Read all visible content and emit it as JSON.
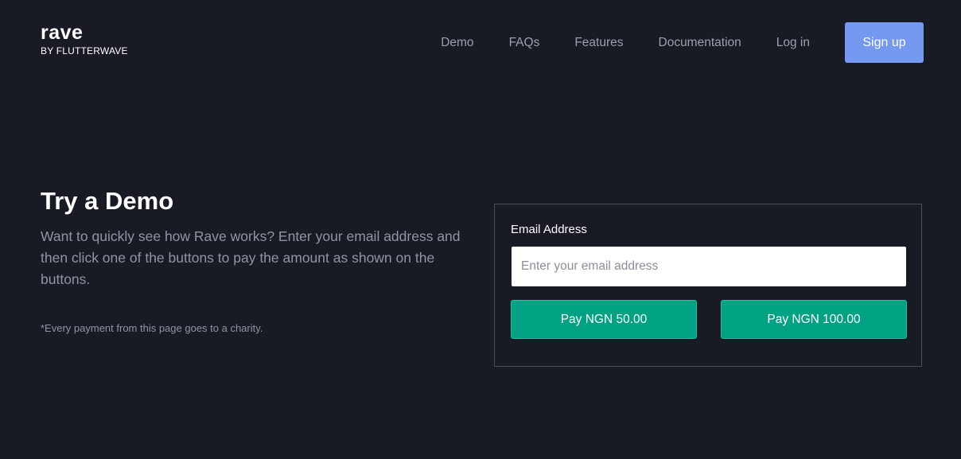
{
  "brand": {
    "name": "rave",
    "tagline": "BY FLUTTERWAVE"
  },
  "nav": {
    "links": [
      "Demo",
      "FAQs",
      "Features",
      "Documentation",
      "Log in"
    ],
    "signup_label": "Sign up"
  },
  "intro": {
    "title": "Try a Demo",
    "description": "Want to quickly see how Rave works? Enter your email address and then click one of the buttons to pay the amount as shown on the buttons.",
    "note": "*Every payment from this page goes to a charity."
  },
  "form": {
    "email_label": "Email Address",
    "email_placeholder": "Enter your email address",
    "email_value": "",
    "pay_buttons": [
      "Pay NGN 50.00",
      "Pay NGN 100.00"
    ]
  },
  "colors": {
    "background": "#181b24",
    "signup": "#7599f0",
    "pay_button": "#00a283",
    "muted_text": "#8f95a3"
  }
}
